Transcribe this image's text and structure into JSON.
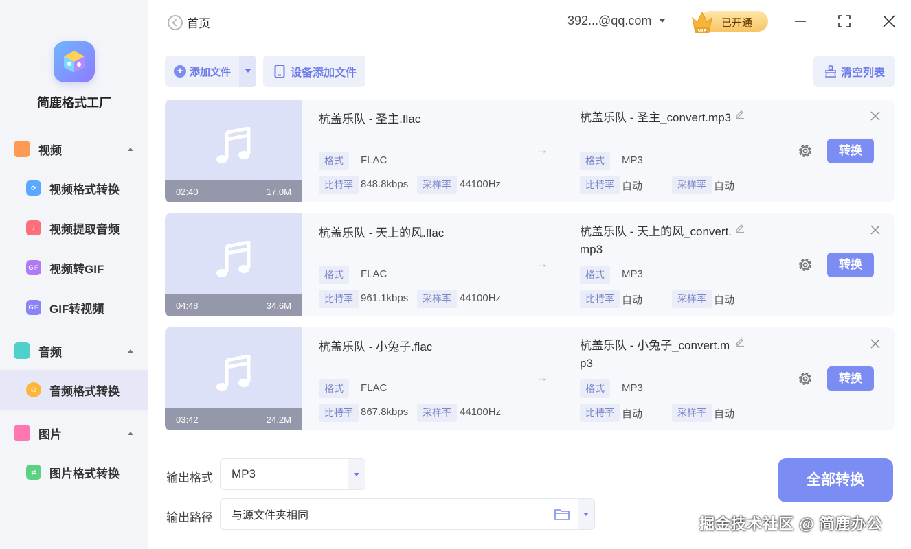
{
  "app": {
    "name": "简鹿格式工厂"
  },
  "sidebar": {
    "sections": [
      {
        "label": "视频",
        "color": "#ff9a55"
      },
      {
        "label": "音频",
        "color": "#4fd0c8"
      },
      {
        "label": "图片",
        "color": "#ff76b0"
      }
    ],
    "items": [
      {
        "label": "视频格式转换",
        "icon": "video-convert-icon",
        "color": "#5aa8ff"
      },
      {
        "label": "视频提取音频",
        "icon": "music-note-icon",
        "color": "#ff6f7a"
      },
      {
        "label": "视频转GIF",
        "icon": "gif-icon",
        "color": "#b079f5"
      },
      {
        "label": "GIF转视频",
        "icon": "gif-to-video-icon",
        "color": "#8b84f7"
      },
      {
        "label": "音频格式转换",
        "icon": "headphones-icon",
        "color": "#ffb53a"
      },
      {
        "label": "图片格式转换",
        "icon": "image-convert-icon",
        "color": "#5bd282"
      }
    ]
  },
  "header": {
    "home_label": "首页",
    "account": "392...@qq.com",
    "vip_label": "已开通"
  },
  "toolbar": {
    "add_file": "添加文件",
    "device_add": "设备添加文件",
    "clear_list": "清空列表"
  },
  "files": [
    {
      "duration": "02:40",
      "size": "17.0M",
      "source_name": "杭盖乐队 - 圣主.flac",
      "source_format": "FLAC",
      "source_bitrate": "848.8kbps",
      "source_samplerate": "44100Hz",
      "output_name": "杭盖乐队 - 圣主_convert.mp3",
      "output_format": "MP3",
      "output_bitrate": "自动",
      "output_samplerate": "自动"
    },
    {
      "duration": "04:48",
      "size": "34.6M",
      "source_name": "杭盖乐队 - 天上的风.flac",
      "source_format": "FLAC",
      "source_bitrate": "961.1kbps",
      "source_samplerate": "44100Hz",
      "output_name": "杭盖乐队 - 天上的风_convert.mp3",
      "output_format": "MP3",
      "output_bitrate": "自动",
      "output_samplerate": "自动"
    },
    {
      "duration": "03:42",
      "size": "24.2M",
      "source_name": "杭盖乐队 - 小兔子.flac",
      "source_format": "FLAC",
      "source_bitrate": "867.8kbps",
      "source_samplerate": "44100Hz",
      "output_name": "杭盖乐队 - 小兔子_convert.mp3",
      "output_format": "MP3",
      "output_bitrate": "自动",
      "output_samplerate": "自动"
    }
  ],
  "labels": {
    "format": "格式",
    "bitrate": "比特率",
    "samplerate": "采样率",
    "convert": "转换"
  },
  "bottom": {
    "output_format_label": "输出格式",
    "output_format_value": "MP3",
    "output_path_label": "输出路径",
    "output_path_value": "与源文件夹相同",
    "convert_all": "全部转换"
  },
  "watermark": "掘金技术社区 @ 简鹿办公",
  "colors": {
    "accent": "#7b8cf2",
    "sidebar_bg": "#f4f5f9",
    "active_item_bg": "#e6e8f7"
  }
}
